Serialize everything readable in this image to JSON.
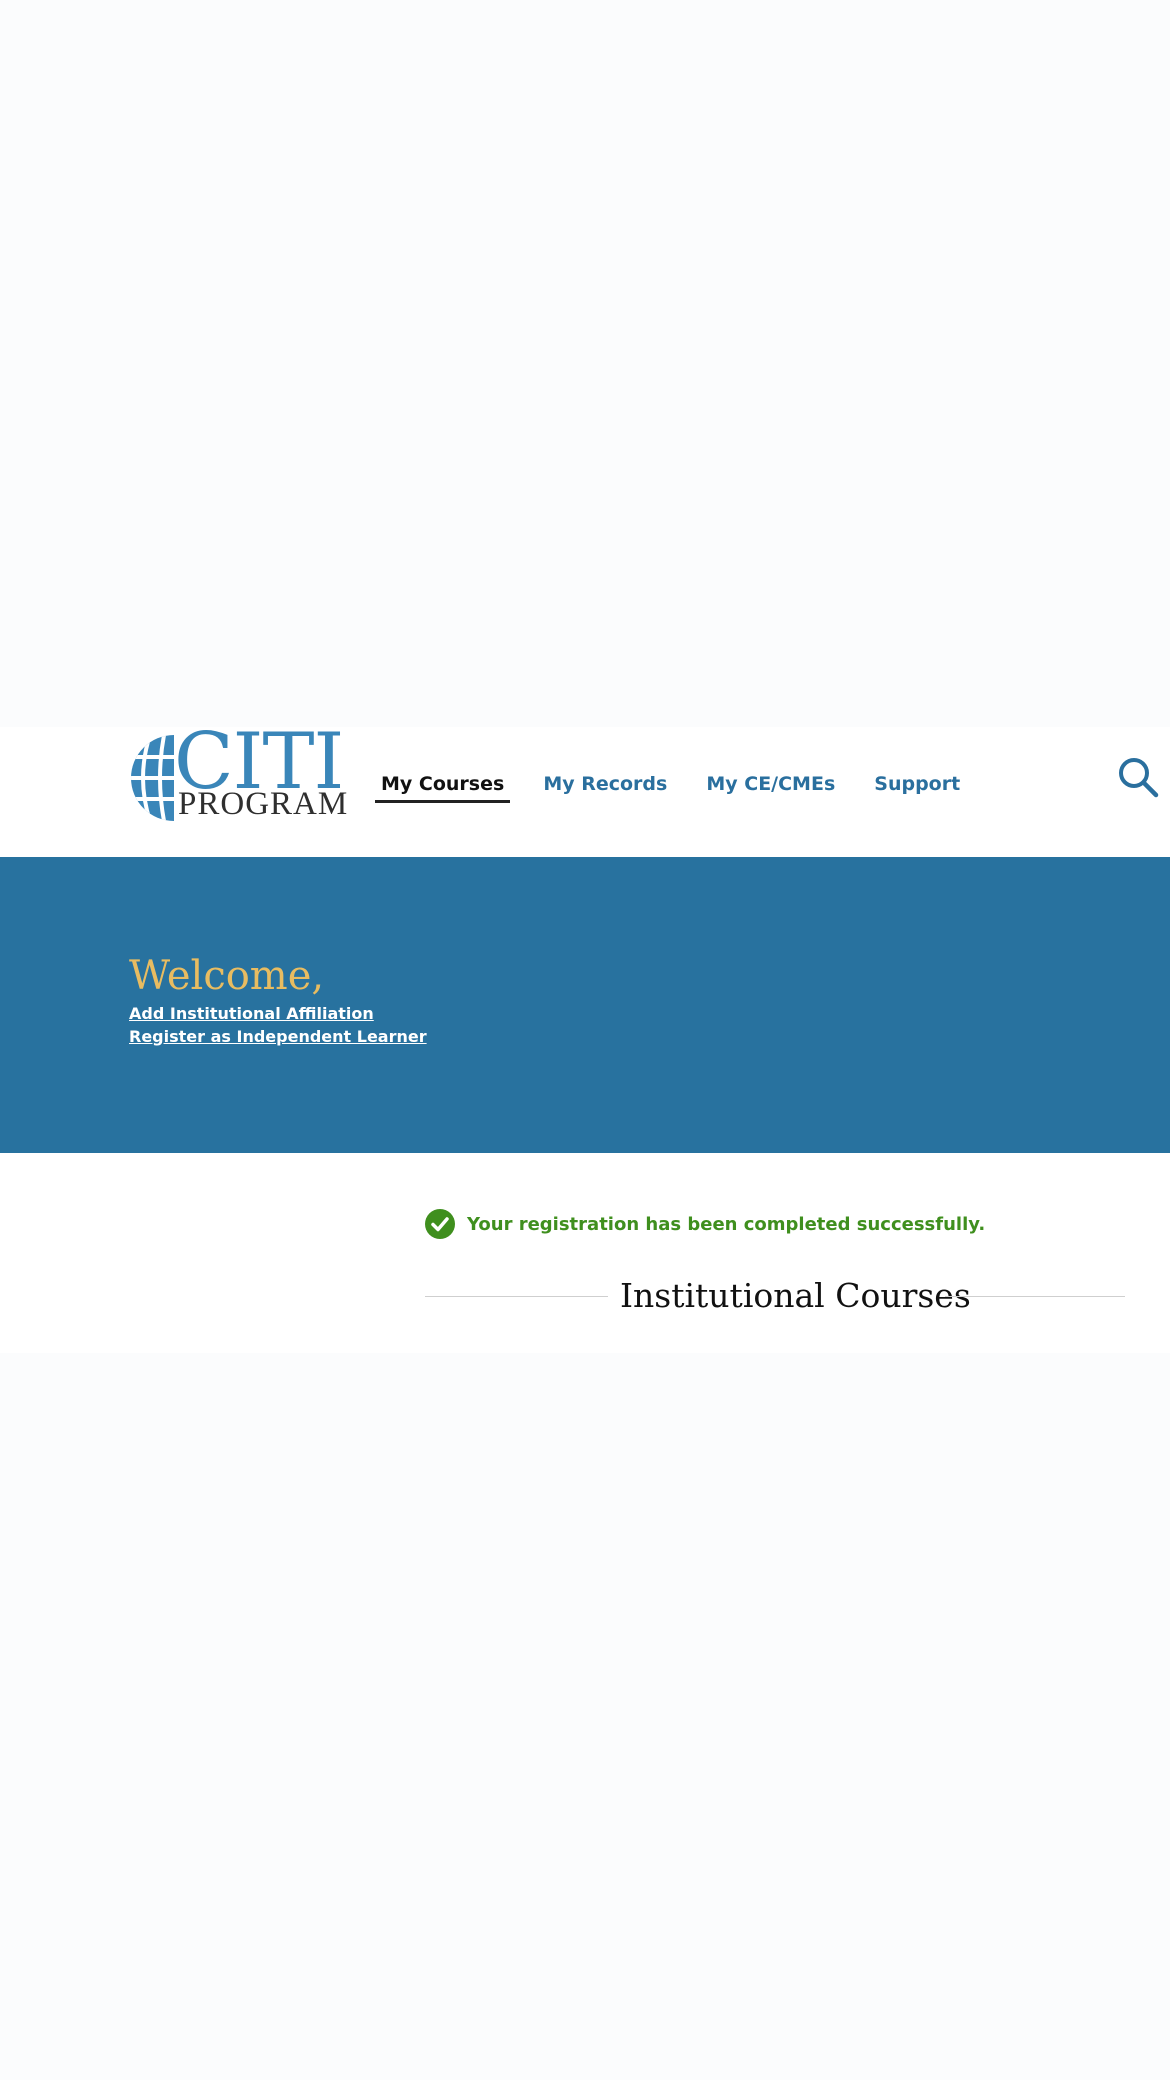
{
  "brand": {
    "logo_word_top": "CITI",
    "logo_word_bottom": "PROGRAM",
    "primary_color": "#28729f",
    "accent_color": "#e8bc61",
    "logo_color": "#3a86b9"
  },
  "nav": {
    "items": [
      {
        "label": "My Courses",
        "active": true
      },
      {
        "label": "My Records",
        "active": false
      },
      {
        "label": "My CE/CMEs",
        "active": false
      },
      {
        "label": "Support",
        "active": false
      }
    ],
    "search_icon": "search-icon"
  },
  "banner": {
    "welcome": "Welcome,",
    "links": [
      "Add Institutional Affiliation",
      "Register as Independent Learner"
    ]
  },
  "alert": {
    "icon": "check-circle-icon",
    "message": "Your registration has been completed successfully.",
    "color": "#3f8f1e"
  },
  "section": {
    "title": "Institutional Courses"
  }
}
